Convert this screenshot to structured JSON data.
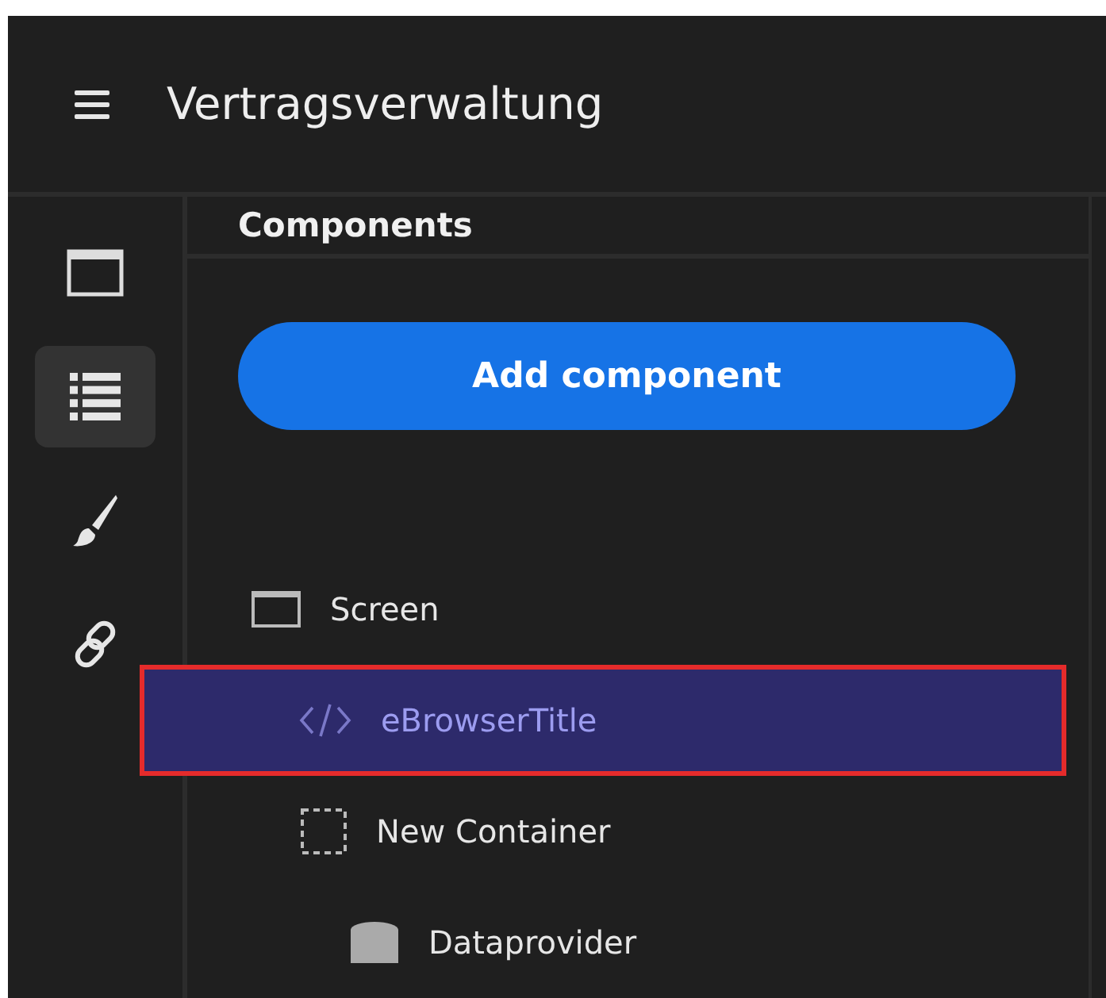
{
  "header": {
    "title": "Vertragsverwaltung"
  },
  "rail": [
    {
      "kind": "window",
      "selected": false
    },
    {
      "kind": "list",
      "selected": true
    },
    {
      "kind": "brush",
      "selected": false
    },
    {
      "kind": "link",
      "selected": false
    }
  ],
  "panel": {
    "title": "Components",
    "add_button": "Add component",
    "tree": [
      {
        "label": "Screen",
        "kind": "screen",
        "selected": false,
        "children": [
          {
            "label": "eBrowserTitle",
            "kind": "code",
            "selected": true
          },
          {
            "label": "New Container",
            "kind": "container",
            "selected": false,
            "children": [
              {
                "label": "Dataprovider",
                "kind": "database",
                "selected": false
              }
            ]
          }
        ]
      }
    ]
  }
}
